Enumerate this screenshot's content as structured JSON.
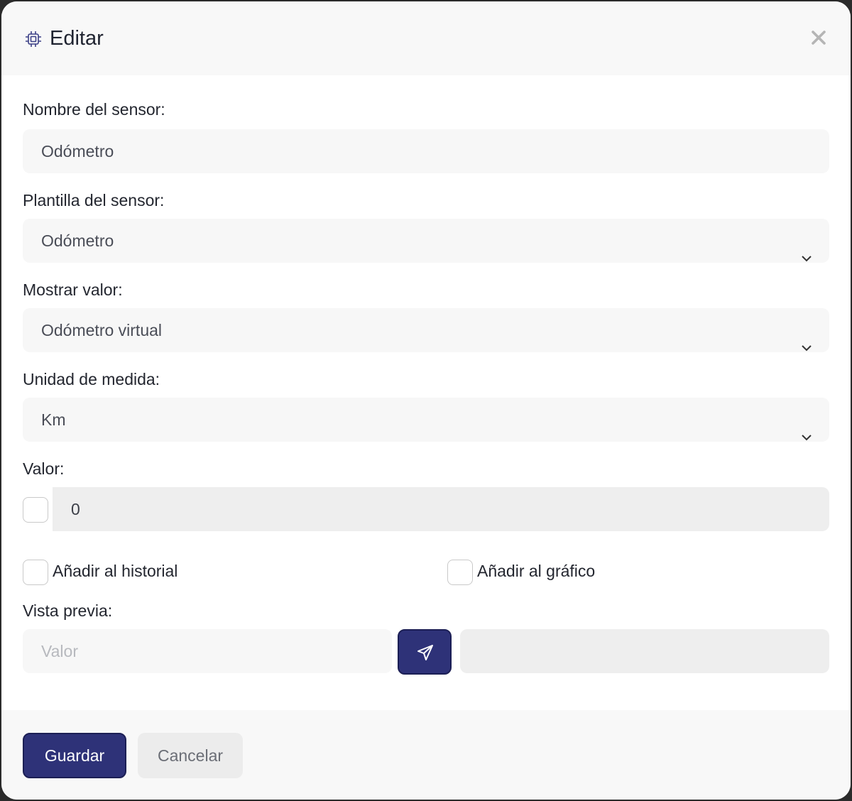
{
  "header": {
    "icon": "chip-icon",
    "title": "Editar",
    "close_icon": "close-icon"
  },
  "form": {
    "sensor_name": {
      "label": "Nombre del sensor:",
      "value": "Odómetro"
    },
    "sensor_template": {
      "label": "Plantilla del sensor:",
      "value": "Odómetro"
    },
    "show_value": {
      "label": "Mostrar valor:",
      "value": "Odómetro virtual"
    },
    "unit": {
      "label": "Unidad de medida:",
      "value": "Km"
    },
    "value": {
      "label": "Valor:",
      "value": "0",
      "checked": false
    },
    "add_history": {
      "label": "Añadir al historial",
      "checked": false
    },
    "add_chart": {
      "label": "Añadir al gráfico",
      "checked": false
    },
    "preview": {
      "label": "Vista previa:",
      "placeholder": "Valor",
      "send_icon": "send-icon",
      "result": ""
    }
  },
  "footer": {
    "save_label": "Guardar",
    "cancel_label": "Cancelar"
  },
  "colors": {
    "primary": "#2e3278",
    "field_bg": "#f7f7f7",
    "disabled_bg": "#eeeeee"
  }
}
